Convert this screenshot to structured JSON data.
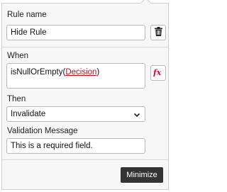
{
  "rule": {
    "name_label": "Rule name",
    "name_value": "Hide Rule",
    "delete_icon": "trash-icon"
  },
  "when": {
    "label": "When",
    "expression_prefix": "isNullOrEmpty(",
    "expression_link": "Decision",
    "expression_suffix": ")",
    "function_icon": "fx-icon"
  },
  "then": {
    "label": "Then",
    "selected_value": "Invalidate"
  },
  "validation": {
    "label": "Validation Message",
    "value": "This is a required field."
  },
  "footer": {
    "minimize_label": "Minimize"
  },
  "colors": {
    "link": "#b3121d",
    "button_bg": "#333333",
    "fx_icon": "#c8102e"
  }
}
